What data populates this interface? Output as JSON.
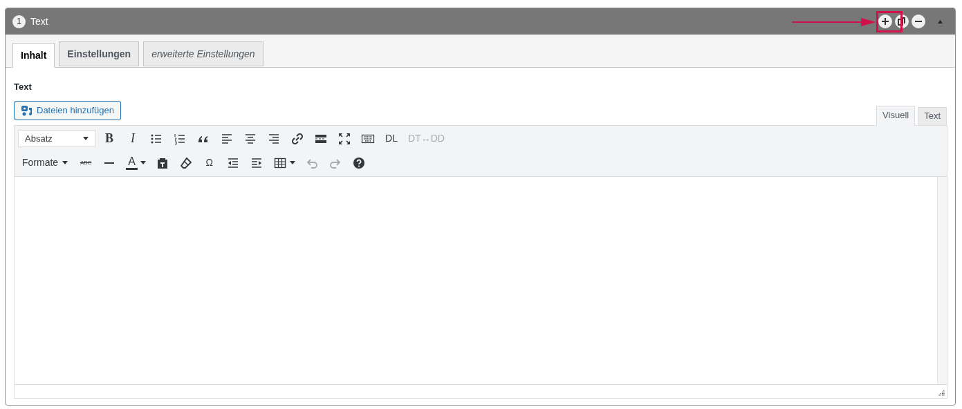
{
  "panel": {
    "number": "1",
    "title": "Text"
  },
  "tabs": [
    {
      "label": "Inhalt",
      "selected": true,
      "italic": false
    },
    {
      "label": "Einstellungen",
      "selected": false,
      "italic": false
    },
    {
      "label": "erweiterte Einstellungen",
      "selected": false,
      "italic": true
    }
  ],
  "field_label": "Text",
  "add_media_button": "Dateien hinzufügen",
  "editor_tabs": [
    {
      "label": "Visuell",
      "selected": true
    },
    {
      "label": "Text",
      "selected": false
    }
  ],
  "toolbar_rows": [
    [
      {
        "kind": "select",
        "label": "Absatz"
      },
      {
        "kind": "bold",
        "label": "B",
        "disabled": false
      },
      {
        "kind": "italic",
        "label": "I",
        "disabled": false
      },
      {
        "kind": "icon",
        "disabled": false
      },
      {
        "kind": "icon",
        "disabled": false
      },
      {
        "kind": "icon",
        "disabled": false
      },
      {
        "kind": "icon",
        "disabled": false
      },
      {
        "kind": "icon",
        "disabled": false
      },
      {
        "kind": "icon",
        "disabled": false
      },
      {
        "kind": "icon",
        "disabled": false
      },
      {
        "kind": "icon",
        "disabled": false
      },
      {
        "kind": "icon",
        "disabled": false
      },
      {
        "kind": "icon",
        "disabled": false
      },
      {
        "kind": "text",
        "label": "DL",
        "disabled": false
      },
      {
        "kind": "text",
        "label": "DT↔DD",
        "disabled": true
      }
    ],
    [
      {
        "kind": "menu",
        "label": "Formate"
      },
      {
        "kind": "strike",
        "label": "ABC",
        "disabled": false
      },
      {
        "kind": "icon",
        "disabled": false
      },
      {
        "kind": "color",
        "label": "A",
        "color": "#32373c",
        "disabled": false
      },
      {
        "kind": "icon",
        "disabled": false
      },
      {
        "kind": "icon",
        "disabled": false
      },
      {
        "kind": "text",
        "label": "Ω",
        "disabled": false
      },
      {
        "kind": "icon",
        "disabled": false
      },
      {
        "kind": "icon",
        "disabled": false
      },
      {
        "kind": "icon_menu",
        "disabled": false
      },
      {
        "kind": "icon",
        "disabled": true
      },
      {
        "kind": "icon",
        "disabled": true
      },
      {
        "kind": "icon",
        "disabled": false
      }
    ]
  ]
}
